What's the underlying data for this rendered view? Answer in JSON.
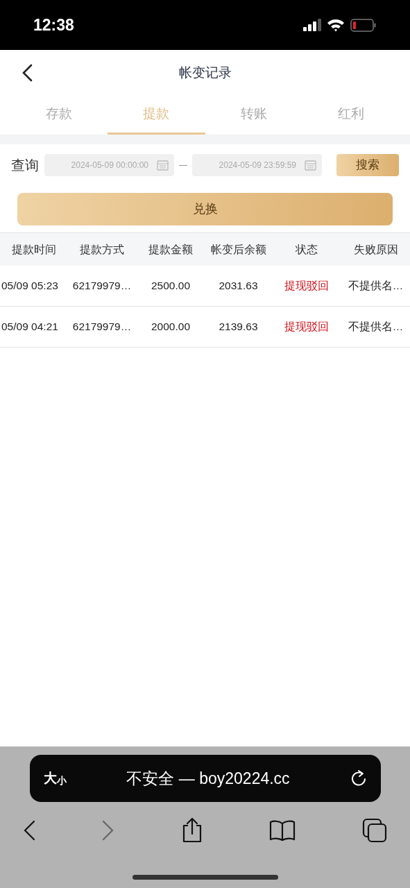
{
  "status_bar": {
    "time": "12:38"
  },
  "nav": {
    "title": "帐变记录"
  },
  "tabs": [
    {
      "label": "存款",
      "selected": false
    },
    {
      "label": "提款",
      "selected": true
    },
    {
      "label": "转账",
      "selected": false
    },
    {
      "label": "红利",
      "selected": false
    }
  ],
  "query": {
    "label": "查询",
    "start": "2024-05-09 00:00:00",
    "separator": "—",
    "end": "2024-05-09 23:59:59",
    "search_button": "搜索"
  },
  "exchange_button": "兑换",
  "table": {
    "columns": [
      "提款时间",
      "提款方式",
      "提款金额",
      "帐变后余额",
      "状态",
      "失败原因"
    ],
    "rows": [
      {
        "time": "05/09 05:23",
        "method": "62179979…",
        "amount": "2500.00",
        "balance": "2031.63",
        "status": "提现驳回",
        "color": "#d0121b",
        "reason": "不提供名…"
      },
      {
        "time": "05/09 04:21",
        "method": "62179979…",
        "amount": "2000.00",
        "balance": "2139.63",
        "status": "提现驳回",
        "color": "#d0121b",
        "reason": "不提供名…"
      }
    ]
  },
  "browser": {
    "text_size_large": "大",
    "text_size_small": "小",
    "address": "不安全 — boy20224.cc",
    "forward_disabled": true
  }
}
